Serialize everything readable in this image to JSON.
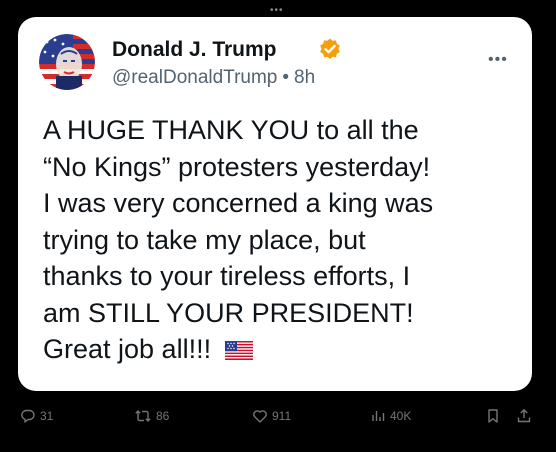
{
  "post": {
    "author": {
      "display_name": "Donald J. Trump",
      "handle": "@realDonaldTrump",
      "time": "8h",
      "separator": "•"
    },
    "text": "A HUGE THANK YOU to all the\n“No Kings” protesters yesterday!\nI was very concerned a king was\ntrying to take my place, but\nthanks to your tireless efforts, I\nam STILL YOUR PRESIDENT!\nGreat job all!!!",
    "emoji": "us-flag-icon"
  },
  "actions": {
    "replies": "31",
    "reposts": "86",
    "likes": "911",
    "views": "40K"
  },
  "colors": {
    "background": "#000000",
    "card": "#ffffff",
    "text": "#0f1419",
    "secondary_text": "#536471",
    "action_icons": "#71767b",
    "verified_badge": "#f4a00c"
  }
}
